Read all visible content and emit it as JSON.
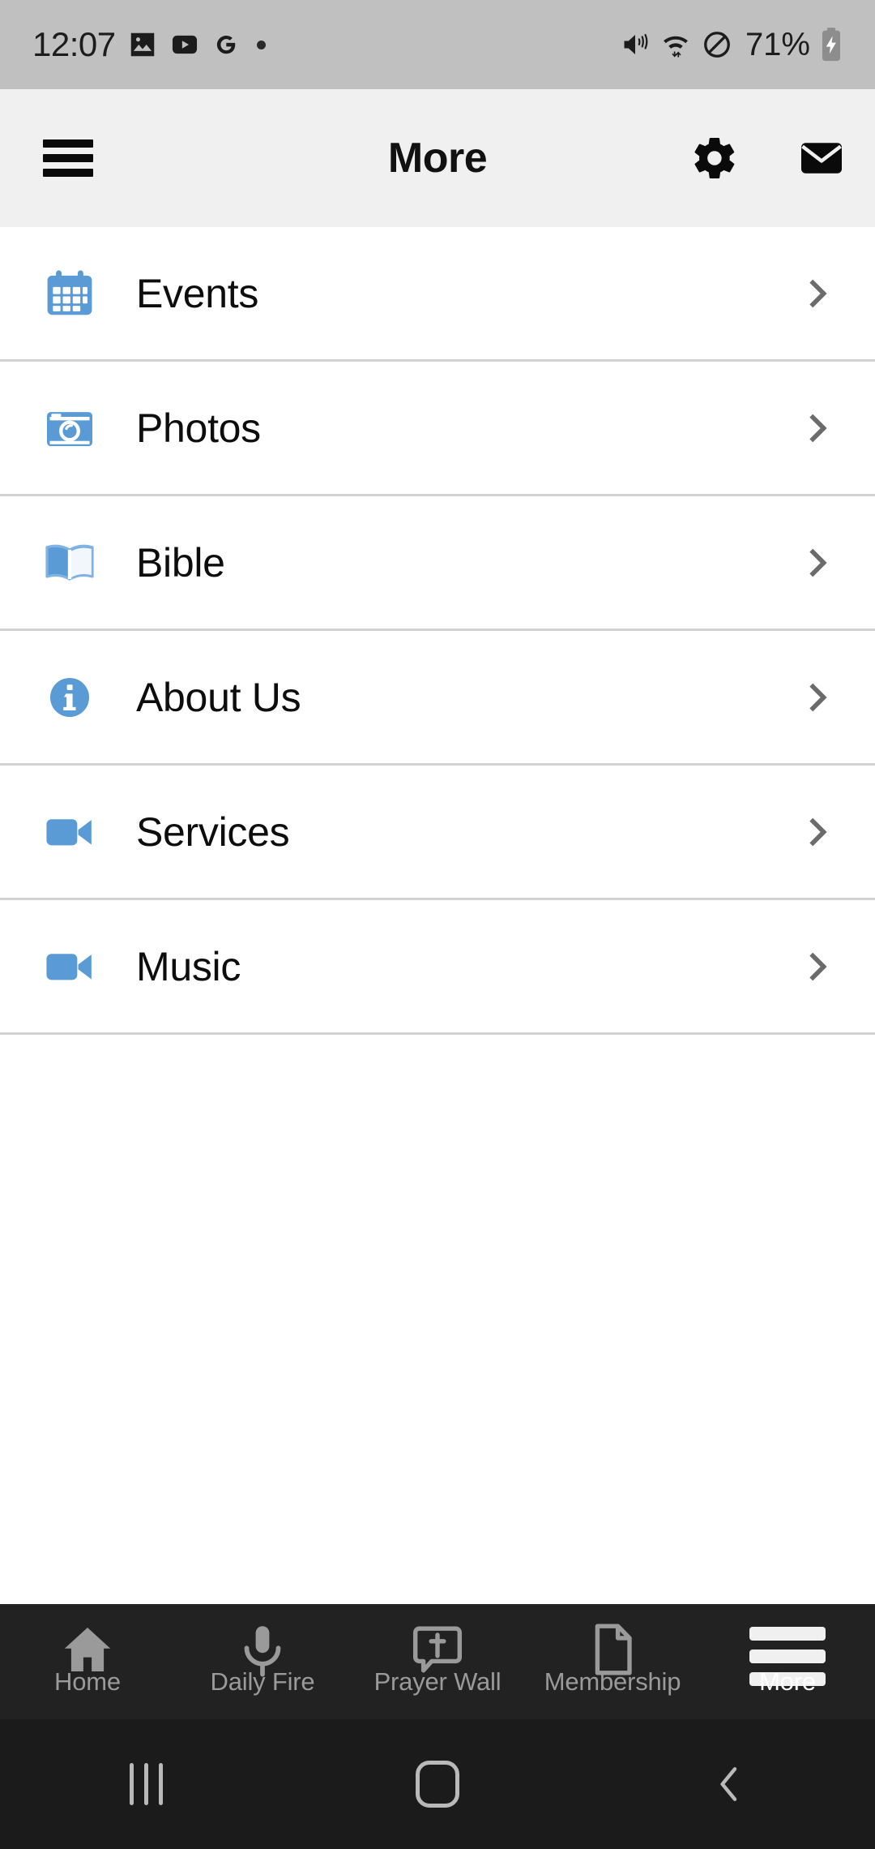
{
  "status_bar": {
    "time": "12:07",
    "battery_percent": "71%",
    "left_icons": [
      "photos-icon",
      "youtube-icon",
      "google-icon",
      "notification-dot-icon"
    ],
    "right_icons": [
      "vibrate-mute-icon",
      "wifi-icon",
      "do-not-disturb-icon",
      "battery-charging-icon"
    ],
    "background": "#c0c0c0"
  },
  "app_bar": {
    "title": "More",
    "menu_icon": "hamburger-menu-icon",
    "actions": [
      {
        "name": "settings",
        "icon": "gear-icon"
      },
      {
        "name": "mail",
        "icon": "envelope-icon"
      }
    ],
    "background": "#f0f0f0"
  },
  "list": {
    "accent_color": "#5b9bd5",
    "chevron_color": "#6b6b6b",
    "divider_color": "#d3d3d3",
    "items": [
      {
        "label": "Events",
        "icon": "calendar-icon",
        "chevron": "chevron-right-icon"
      },
      {
        "label": "Photos",
        "icon": "camera-icon",
        "chevron": "chevron-right-icon"
      },
      {
        "label": "Bible",
        "icon": "open-book-icon",
        "chevron": "chevron-right-icon"
      },
      {
        "label": "About Us",
        "icon": "info-circle-icon",
        "chevron": "chevron-right-icon"
      },
      {
        "label": "Services",
        "icon": "video-camera-icon",
        "chevron": "chevron-right-icon"
      },
      {
        "label": "Music",
        "icon": "video-camera-icon",
        "chevron": "chevron-right-icon"
      }
    ]
  },
  "bottom_nav": {
    "background": "#222222",
    "active_color": "#ffffff",
    "inactive_color": "#9a9a9a",
    "items": [
      {
        "label": "Home",
        "icon": "house-icon",
        "active": false
      },
      {
        "label": "Daily Fire",
        "icon": "microphone-icon",
        "active": false
      },
      {
        "label": "Prayer Wall",
        "icon": "speech-bubble-cross-icon",
        "active": false
      },
      {
        "label": "Membership",
        "icon": "document-page-icon",
        "active": false
      },
      {
        "label": "More",
        "icon": "hamburger-menu-icon",
        "active": true
      }
    ]
  },
  "system_nav": {
    "background": "#1b1b1b",
    "buttons": [
      {
        "name": "recents",
        "icon": "recents-icon"
      },
      {
        "name": "home",
        "icon": "home-square-icon"
      },
      {
        "name": "back",
        "icon": "back-chevron-icon"
      }
    ]
  }
}
